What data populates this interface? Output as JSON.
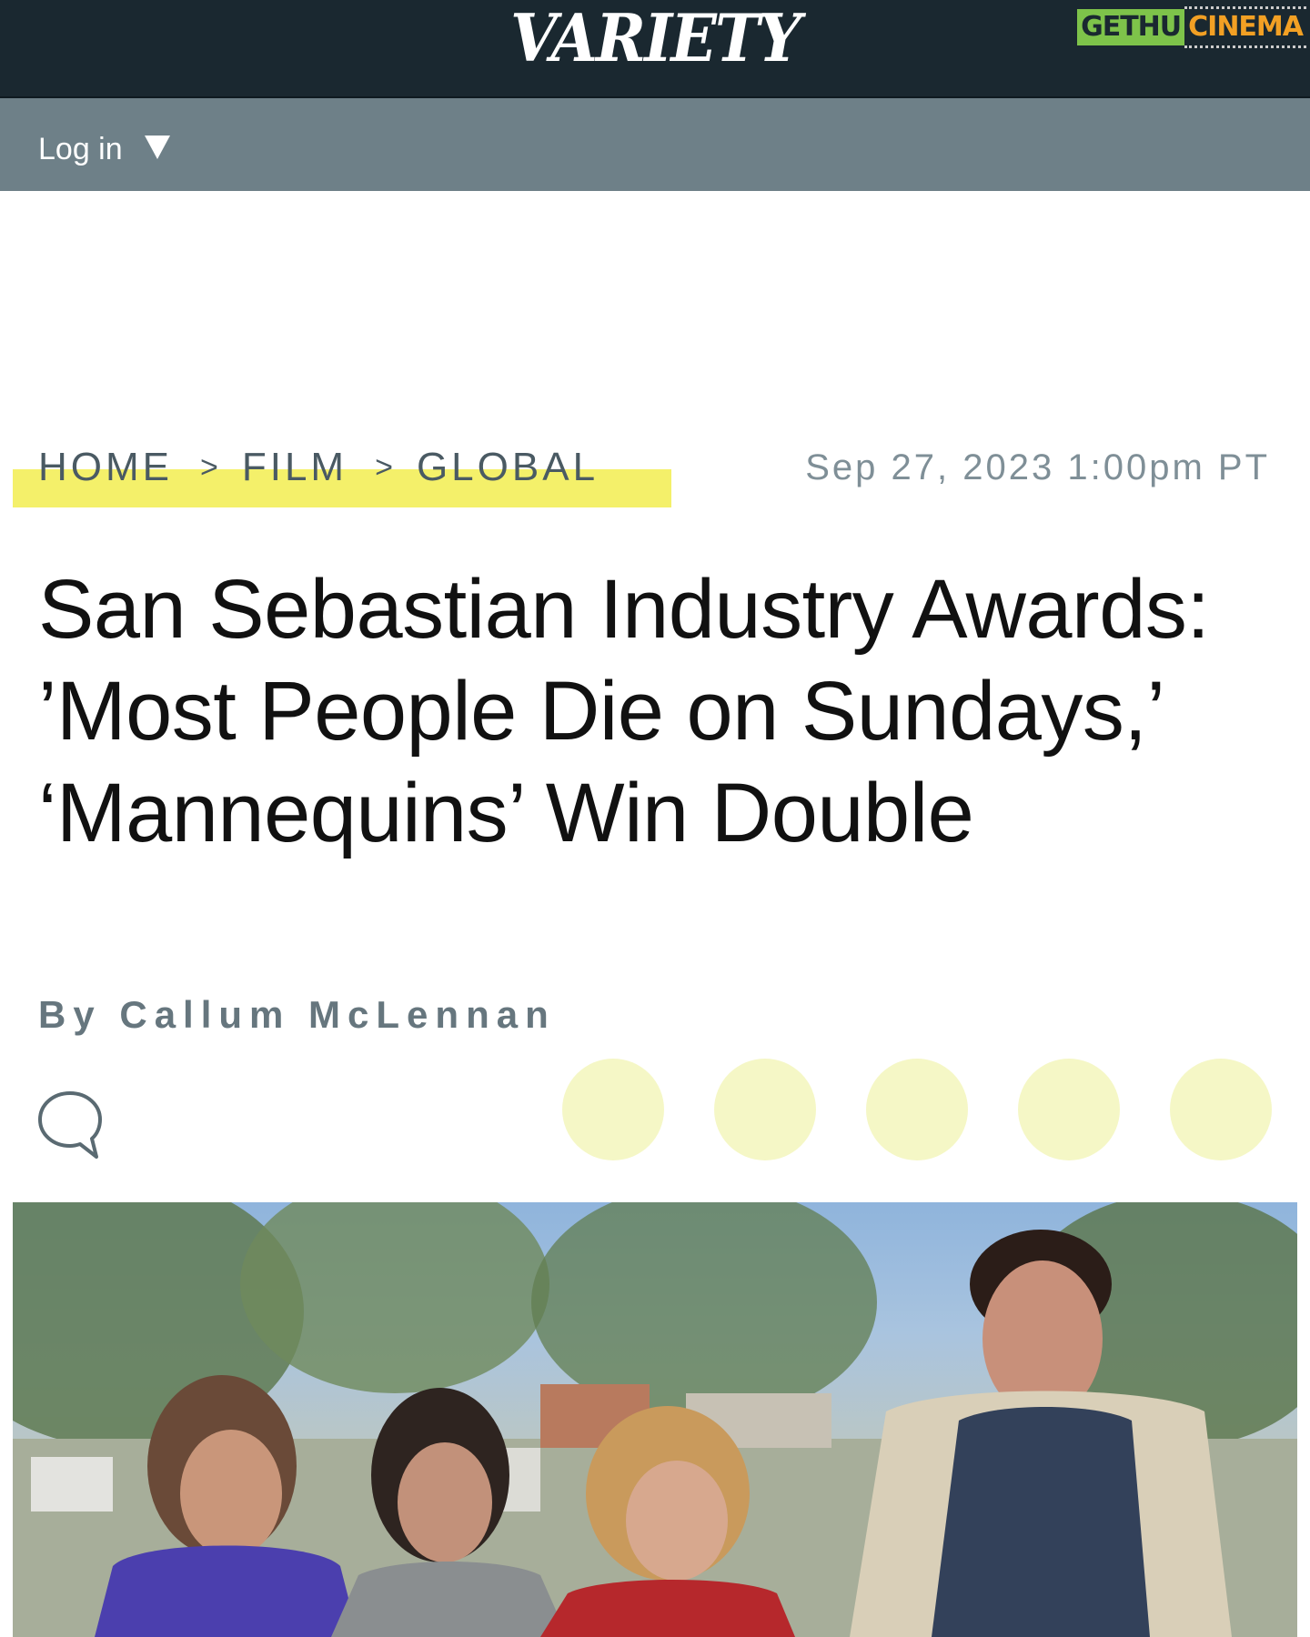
{
  "header": {
    "brand": "VARIETY",
    "watermark": {
      "part1": "GETHU",
      "part2": "CINEMA"
    }
  },
  "login": {
    "label": "Log in"
  },
  "breadcrumb": {
    "items": [
      "HOME",
      "FILM",
      "GLOBAL"
    ],
    "separator": ">",
    "highlight_color": "#f4f06a"
  },
  "article": {
    "date": "Sep 27, 2023 1:00pm PT",
    "headline": "San Sebastian Industry Awards: ’Most People Die on Sundays,’ ‘Mannequins’ Win Double",
    "byline": "By Callum McLennan",
    "comment_icon": "comment-bubble-icon",
    "share_buttons": [
      "share-button-1",
      "share-button-2",
      "share-button-3",
      "share-button-4",
      "share-button-5"
    ],
    "share_color": "#f5f7c6"
  },
  "colors": {
    "header_bg": "#1a2830",
    "login_bar_bg": "#6e8088",
    "text_dark": "#111111",
    "byline_gray": "#66767e"
  }
}
